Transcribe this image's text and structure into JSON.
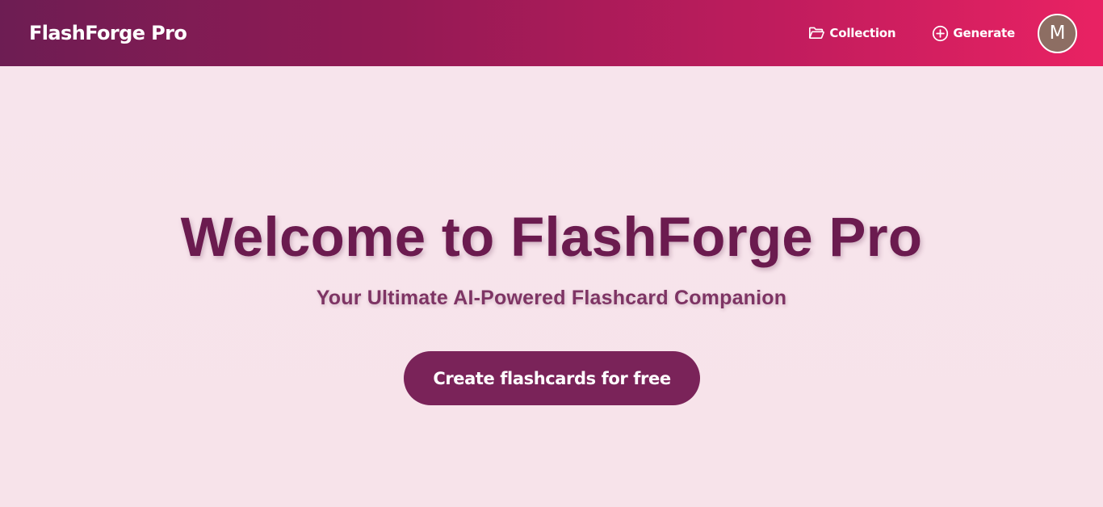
{
  "navbar": {
    "brand": "FlashForge Pro",
    "links": [
      {
        "label": "Collection",
        "icon": "folder-open-icon"
      },
      {
        "label": "Generate",
        "icon": "plus-circle-icon"
      }
    ],
    "avatar_initial": "M",
    "gradient_start": "#6d1d53",
    "gradient_end": "#e92263"
  },
  "hero": {
    "title": "Welcome to FlashForge Pro",
    "subtitle": "Your Ultimate AI-Powered Flashcard Companion",
    "cta_label": "Create flashcards for free",
    "title_color": "#6b1b4f",
    "cta_color": "#7a2359",
    "background": "#f7e4ec"
  },
  "avatar_color": "#8d6e63"
}
